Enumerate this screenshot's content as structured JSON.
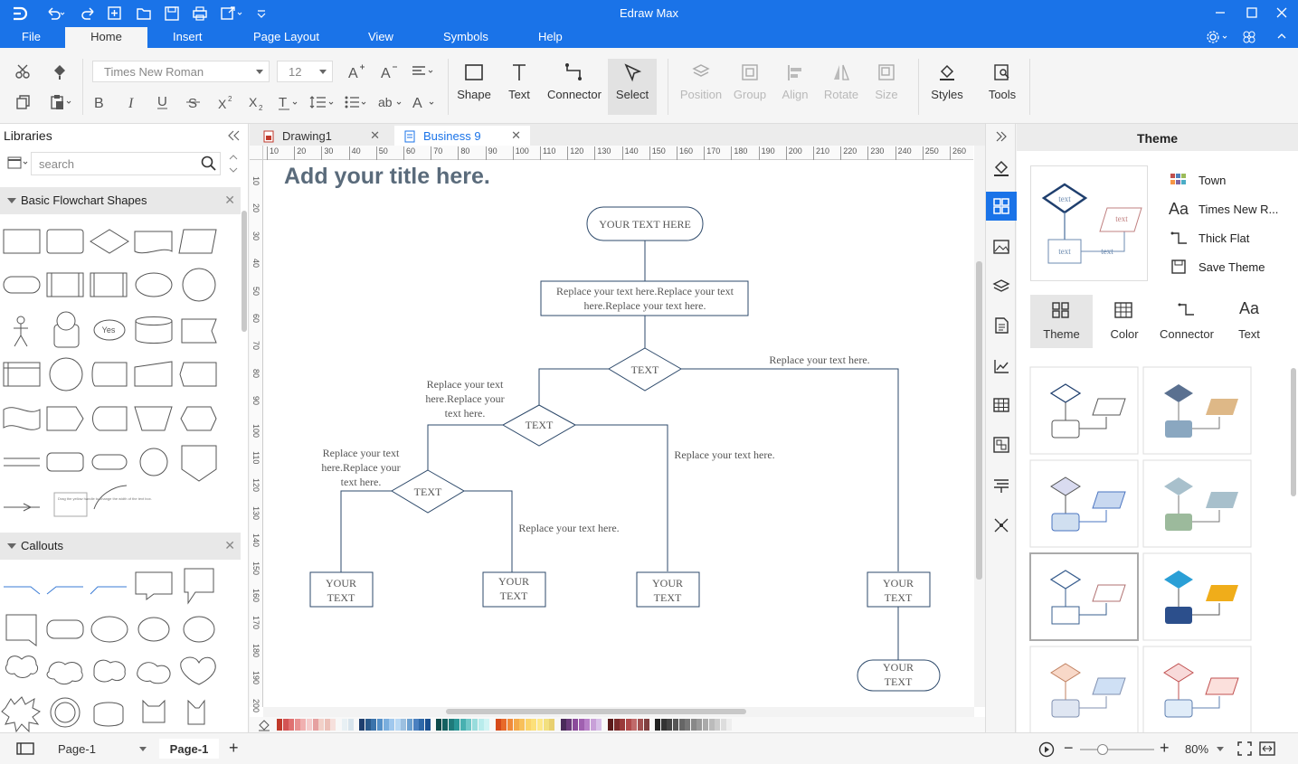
{
  "app": {
    "title": "Edraw Max"
  },
  "menu": {
    "file": "File",
    "home": "Home",
    "insert": "Insert",
    "page_layout": "Page Layout",
    "view": "View",
    "symbols": "Symbols",
    "help": "Help"
  },
  "ribbon": {
    "font_name": "Times New Roman",
    "font_size": "12",
    "shape": "Shape",
    "text": "Text",
    "connector": "Connector",
    "select": "Select",
    "position": "Position",
    "group": "Group",
    "align": "Align",
    "rotate": "Rotate",
    "size": "Size",
    "styles": "Styles",
    "tools": "Tools"
  },
  "libraries": {
    "title": "Libraries",
    "search_placeholder": "search",
    "cat1": "Basic Flowchart Shapes",
    "cat2": "Callouts",
    "note_shape_text": "Drag the yellow handle to change the width of the text box."
  },
  "tabs": [
    {
      "label": "Drawing1"
    },
    {
      "label": "Business 9"
    }
  ],
  "ruler": {
    "h": [
      "10",
      "20",
      "30",
      "40",
      "50",
      "60",
      "70",
      "80",
      "90",
      "100",
      "110",
      "120",
      "130",
      "140",
      "150",
      "160",
      "170",
      "180",
      "190",
      "200",
      "210",
      "220",
      "230",
      "240",
      "250",
      "260"
    ],
    "v": [
      "10",
      "20",
      "30",
      "40",
      "50",
      "60",
      "70",
      "80",
      "90",
      "100",
      "110",
      "120",
      "130",
      "140",
      "150",
      "160",
      "170",
      "180",
      "190",
      "200"
    ]
  },
  "diagram": {
    "title": "Add your title here.",
    "start": "YOUR TEXT HERE",
    "process1_l1": "Replace your text here.Replace your text",
    "process1_l2": "here.Replace your text here.",
    "dec": "TEXT",
    "right_label": "Replace your text here.",
    "left_label_l1": "Replace your text",
    "left_label_l2": "here.Replace your",
    "left_label_l3": "text here.",
    "mid_label": "Replace your text here.",
    "bottom_label": "Replace your text here.",
    "box_l1": "YOUR",
    "box_l2": "TEXT"
  },
  "theme_panel": {
    "title": "Theme",
    "preview_text": "text",
    "options": [
      "Town",
      "Times New R...",
      "Thick Flat",
      "Save Theme"
    ],
    "tabs": [
      "Theme",
      "Color",
      "Connector",
      "Text"
    ]
  },
  "status": {
    "page_select": "Page-1",
    "page_tab": "Page-1",
    "zoom": "80%",
    "zoom_level": 0.3
  },
  "colors": {
    "accent": "#1a73e8"
  }
}
